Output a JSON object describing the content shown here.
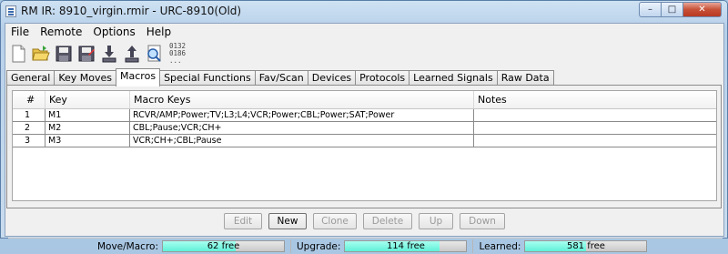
{
  "window": {
    "title": "RM IR: 8910_virgin.rmir - URC-8910(Old)"
  },
  "menu": [
    "File",
    "Remote",
    "Options",
    "Help"
  ],
  "toolbar": {
    "buttons": [
      "new-file-icon",
      "open-folder-icon",
      "save-icon",
      "save-as-icon",
      "download-from-remote-icon",
      "upload-to-remote-icon",
      "raw-data-icon"
    ],
    "codes_lines": [
      "0132",
      "0186",
      "..."
    ]
  },
  "tabs": [
    "General",
    "Key Moves",
    "Macros",
    "Special Functions",
    "Fav/Scan",
    "Devices",
    "Protocols",
    "Learned Signals",
    "Raw Data"
  ],
  "active_tab": "Macros",
  "table": {
    "headers": [
      "#",
      "Key",
      "Macro Keys",
      "Notes"
    ],
    "rows": [
      [
        "1",
        "M1",
        "RCVR/AMP;Power;TV;L3;L4;VCR;Power;CBL;Power;SAT;Power",
        ""
      ],
      [
        "2",
        "M2",
        "CBL;Pause;VCR;CH+",
        ""
      ],
      [
        "3",
        "M3",
        "VCR;CH+;CBL;Pause",
        ""
      ]
    ]
  },
  "buttons": {
    "edit": "Edit",
    "new": "New",
    "clone": "Clone",
    "delete": "Delete",
    "up": "Up",
    "down": "Down"
  },
  "status": {
    "move_macro": {
      "label": "Move/Macro:",
      "text": "62 free",
      "fill": 0.6
    },
    "upgrade": {
      "label": "Upgrade:",
      "text": "114 free",
      "fill": 0.78
    },
    "learned": {
      "label": "Learned:",
      "text": "581 free",
      "fill": 0.5
    }
  },
  "colors": {
    "progress_fill": "#6ff3dc",
    "title_bar": "#b7d0e9"
  }
}
